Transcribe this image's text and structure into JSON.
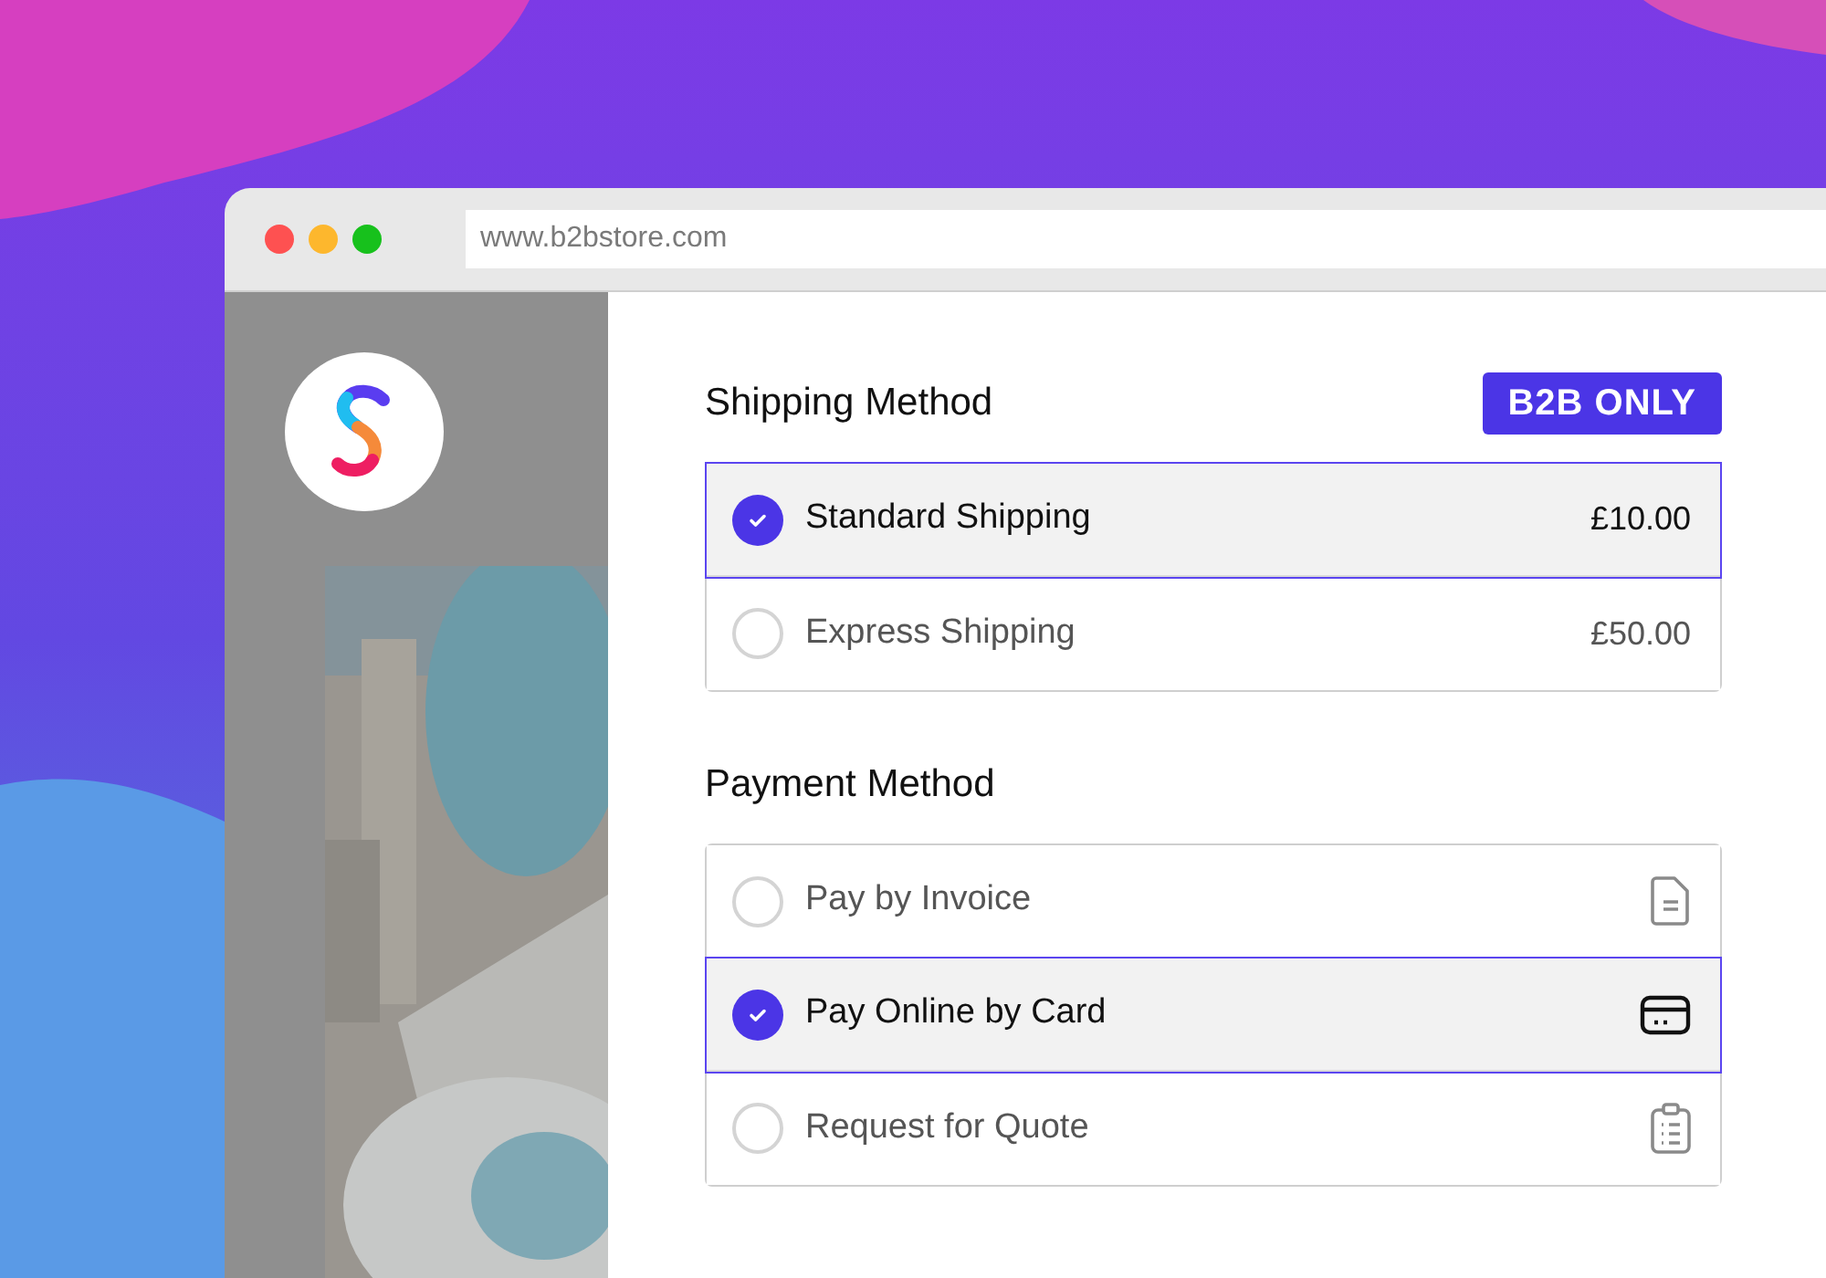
{
  "browser": {
    "url": "www.b2bstore.com"
  },
  "shipping": {
    "title": "Shipping Method",
    "badge": "B2B ONLY",
    "options": [
      {
        "label": "Standard Shipping",
        "price": "£10.00",
        "selected": true
      },
      {
        "label": "Express Shipping",
        "price": "£50.00",
        "selected": false
      }
    ]
  },
  "payment": {
    "title": "Payment Method",
    "options": [
      {
        "label": "Pay by Invoice",
        "kind": "invoice",
        "selected": false
      },
      {
        "label": "Pay Online by Card",
        "kind": "card",
        "selected": true
      },
      {
        "label": "Request for Quote",
        "kind": "quote",
        "selected": false
      }
    ]
  }
}
